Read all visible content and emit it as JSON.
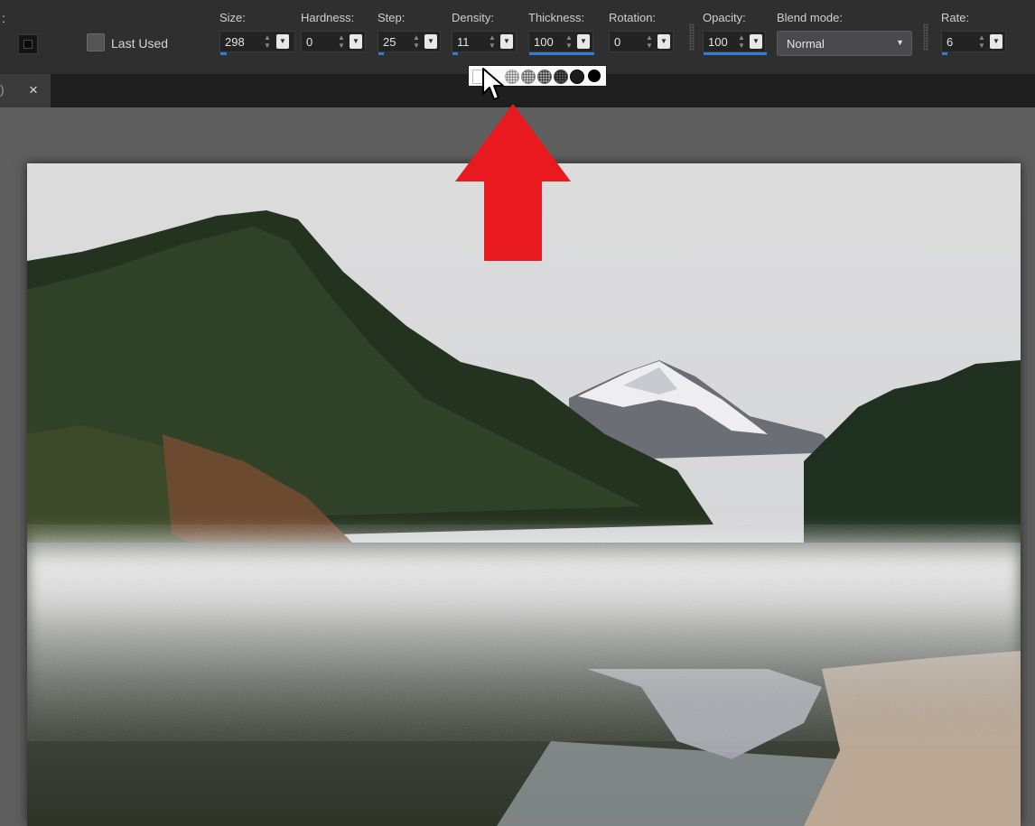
{
  "toolbar": {
    "leading_colon": ":",
    "last_used_label": "Last Used",
    "fields": {
      "size": {
        "label": "Size:",
        "value": "298",
        "fill": 0.08
      },
      "hardness": {
        "label": "Hardness:",
        "value": "0",
        "fill": 0.0
      },
      "step": {
        "label": "Step:",
        "value": "25",
        "fill": 0.08
      },
      "density": {
        "label": "Density:",
        "value": "11",
        "fill": 0.08
      },
      "thickness": {
        "label": "Thickness:",
        "value": "100",
        "fill": 1.0
      },
      "rotation": {
        "label": "Rotation:",
        "value": "0",
        "fill": 0.0
      },
      "opacity": {
        "label": "Opacity:",
        "value": "100",
        "fill": 1.0
      },
      "rate": {
        "label": "Rate:",
        "value": "6",
        "fill": 0.08
      }
    },
    "blend_mode": {
      "label": "Blend mode:",
      "value": "Normal"
    }
  },
  "tabbar": {
    "left_fragment": ")",
    "close_symbol": "×"
  },
  "icons": {
    "spinner": "spinner-arrows-icon",
    "dropdown": "dropdown-arrow-icon",
    "close": "close-icon",
    "cursor": "mouse-pointer-icon",
    "annotation": "red-up-arrow-icon"
  },
  "colors": {
    "accent": "#2f7fd8",
    "annotation_red": "#e8191f",
    "toolbar_bg": "#2f2f30"
  }
}
